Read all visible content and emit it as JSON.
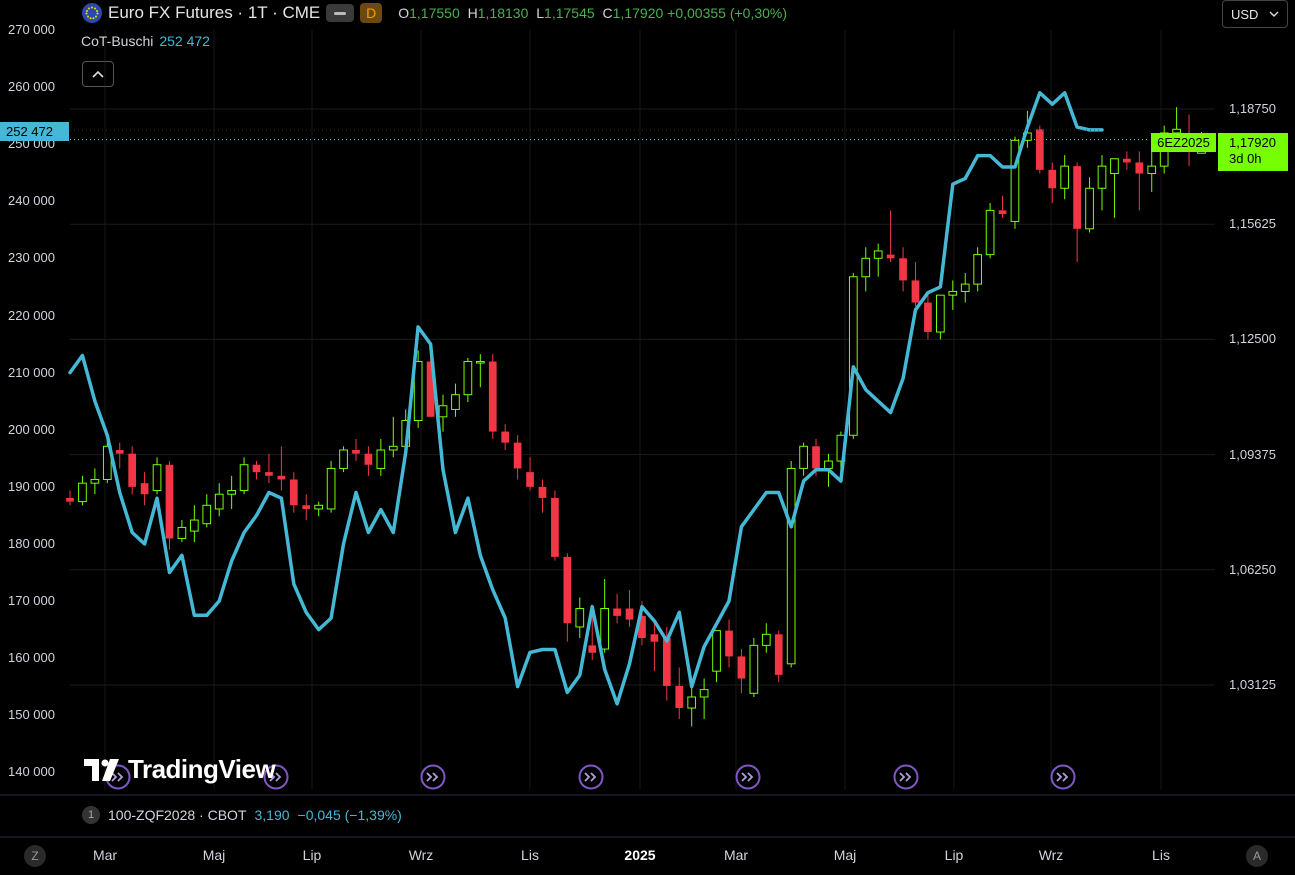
{
  "header": {
    "title": "Euro FX Futures · 1T · CME",
    "flag_icon": "eu-flag-icon",
    "d_badge": "D",
    "open_label": "O",
    "open_value": "1,17550",
    "high_label": "H",
    "high_value": "1,18130",
    "low_label": "L",
    "low_value": "1,17545",
    "close_label": "C",
    "close_value": "1,17920",
    "change": "+0,00355 (+0,30%)",
    "currency": "USD",
    "collapse_icon": "chevron-up-icon"
  },
  "indicator": {
    "name": "CoT-Buschi",
    "value": "252 472",
    "badge": "252 472",
    "color": "#45b8d6"
  },
  "price_badge": {
    "symbol": "6EZ2025",
    "price": "1,17920",
    "countdown": "3d 0h",
    "color": "#76ff03"
  },
  "watermark": "TradingView",
  "secondary_legend": {
    "number": "1",
    "symbol": "100-ZQF2028 · CBOT",
    "value": "3,190",
    "change": "−0,045 (−1,39%)"
  },
  "corner_left": "Z",
  "corner_right": "A",
  "colors": {
    "up": "#76ff03",
    "down": "#f23645",
    "cot_line": "#45b8d6",
    "event_icon": "#7e57c2"
  },
  "chart_data": {
    "type": "line",
    "left_axis": {
      "ticks": [
        "270 000",
        "260 000",
        "250 000",
        "240 000",
        "230 000",
        "220 000",
        "210 000",
        "200 000",
        "190 000",
        "180 000",
        "170 000",
        "160 000",
        "150 000",
        "140 000"
      ],
      "range": [
        140000,
        270000
      ]
    },
    "right_axis": {
      "ticks": [
        "1,18750",
        "1,15625",
        "1,12500",
        "1,09375",
        "1,06250",
        "1,03125"
      ],
      "range": [
        0.99,
        1.203
      ]
    },
    "time_axis": [
      "Mar",
      "Maj",
      "Lip",
      "Wrz",
      "Lis",
      "2025",
      "Mar",
      "Maj",
      "Lip",
      "Wrz",
      "Lis"
    ],
    "grid": true,
    "series": [
      {
        "name": "CoT-Buschi",
        "values": [
          210000,
          213000,
          205000,
          199000,
          189000,
          182000,
          180000,
          188000,
          175000,
          178000,
          167500,
          167500,
          170000,
          177000,
          182000,
          185000,
          189000,
          188000,
          173000,
          168000,
          165000,
          167000,
          180000,
          189000,
          182000,
          186000,
          182000,
          196000,
          218000,
          215000,
          193000,
          182000,
          188000,
          178000,
          172000,
          167000,
          155000,
          161000,
          161500,
          161500,
          154000,
          157000,
          169000,
          158000,
          152000,
          159000,
          169000,
          166500,
          163000,
          168000,
          155000,
          162000,
          166000,
          170000,
          183000,
          186000,
          189000,
          189000,
          183000,
          191000,
          193000,
          193000,
          191000,
          211000,
          207000,
          205000,
          203000,
          209000,
          221000,
          224000,
          225000,
          243000,
          244000,
          248000,
          248000,
          246000,
          246000,
          253000,
          259000,
          257000,
          259000,
          253000,
          252500,
          252500
        ]
      },
      {
        "name": "Euro FX Futures",
        "candles": [
          [
            1.082,
            1.084,
            1.08,
            1.081
          ],
          [
            1.081,
            1.088,
            1.08,
            1.086
          ],
          [
            1.086,
            1.09,
            1.083,
            1.087
          ],
          [
            1.087,
            1.099,
            1.086,
            1.096
          ],
          [
            1.095,
            1.097,
            1.09,
            1.094
          ],
          [
            1.094,
            1.096,
            1.083,
            1.085
          ],
          [
            1.086,
            1.089,
            1.08,
            1.083
          ],
          [
            1.084,
            1.093,
            1.083,
            1.091
          ],
          [
            1.091,
            1.092,
            1.068,
            1.071
          ],
          [
            1.071,
            1.076,
            1.07,
            1.074
          ],
          [
            1.073,
            1.08,
            1.07,
            1.076
          ],
          [
            1.075,
            1.083,
            1.074,
            1.08
          ],
          [
            1.079,
            1.086,
            1.077,
            1.083
          ],
          [
            1.083,
            1.088,
            1.079,
            1.084
          ],
          [
            1.084,
            1.093,
            1.083,
            1.091
          ],
          [
            1.091,
            1.092,
            1.087,
            1.089
          ],
          [
            1.089,
            1.094,
            1.086,
            1.088
          ],
          [
            1.088,
            1.096,
            1.084,
            1.087
          ],
          [
            1.087,
            1.089,
            1.078,
            1.08
          ],
          [
            1.08,
            1.083,
            1.076,
            1.079
          ],
          [
            1.079,
            1.081,
            1.077,
            1.08
          ],
          [
            1.079,
            1.092,
            1.078,
            1.09
          ],
          [
            1.09,
            1.096,
            1.089,
            1.095
          ],
          [
            1.095,
            1.098,
            1.092,
            1.094
          ],
          [
            1.094,
            1.096,
            1.088,
            1.091
          ],
          [
            1.09,
            1.098,
            1.088,
            1.095
          ],
          [
            1.095,
            1.104,
            1.093,
            1.096
          ],
          [
            1.096,
            1.106,
            1.095,
            1.103
          ],
          [
            1.103,
            1.122,
            1.101,
            1.119
          ],
          [
            1.119,
            1.122,
            1.105,
            1.104
          ],
          [
            1.104,
            1.11,
            1.1,
            1.107
          ],
          [
            1.106,
            1.113,
            1.104,
            1.11
          ],
          [
            1.11,
            1.12,
            1.108,
            1.119
          ],
          [
            1.119,
            1.121,
            1.112,
            1.119
          ],
          [
            1.119,
            1.121,
            1.098,
            1.1
          ],
          [
            1.1,
            1.102,
            1.095,
            1.097
          ],
          [
            1.097,
            1.099,
            1.087,
            1.09
          ],
          [
            1.089,
            1.093,
            1.084,
            1.085
          ],
          [
            1.085,
            1.087,
            1.078,
            1.082
          ],
          [
            1.082,
            1.084,
            1.065,
            1.066
          ],
          [
            1.066,
            1.067,
            1.043,
            1.048
          ],
          [
            1.047,
            1.055,
            1.044,
            1.052
          ],
          [
            1.042,
            1.053,
            1.038,
            1.04
          ],
          [
            1.041,
            1.06,
            1.04,
            1.052
          ],
          [
            1.052,
            1.056,
            1.048,
            1.05
          ],
          [
            1.052,
            1.057,
            1.047,
            1.049
          ],
          [
            1.05,
            1.054,
            1.042,
            1.044
          ],
          [
            1.045,
            1.048,
            1.035,
            1.043
          ],
          [
            1.044,
            1.047,
            1.027,
            1.031
          ],
          [
            1.031,
            1.036,
            1.022,
            1.025
          ],
          [
            1.025,
            1.031,
            1.02,
            1.028
          ],
          [
            1.028,
            1.033,
            1.022,
            1.03
          ],
          [
            1.035,
            1.046,
            1.032,
            1.046
          ],
          [
            1.046,
            1.049,
            1.036,
            1.039
          ],
          [
            1.039,
            1.041,
            1.029,
            1.033
          ],
          [
            1.029,
            1.044,
            1.028,
            1.042
          ],
          [
            1.042,
            1.048,
            1.04,
            1.045
          ],
          [
            1.045,
            1.046,
            1.032,
            1.034
          ],
          [
            1.037,
            1.092,
            1.036,
            1.09
          ],
          [
            1.09,
            1.097,
            1.088,
            1.096
          ],
          [
            1.096,
            1.098,
            1.088,
            1.09
          ],
          [
            1.09,
            1.094,
            1.085,
            1.092
          ],
          [
            1.092,
            1.1,
            1.087,
            1.099
          ],
          [
            1.099,
            1.143,
            1.098,
            1.142
          ],
          [
            1.142,
            1.15,
            1.138,
            1.147
          ],
          [
            1.147,
            1.151,
            1.142,
            1.149
          ],
          [
            1.148,
            1.16,
            1.146,
            1.147
          ],
          [
            1.147,
            1.15,
            1.138,
            1.141
          ],
          [
            1.141,
            1.146,
            1.134,
            1.135
          ],
          [
            1.135,
            1.138,
            1.125,
            1.127
          ],
          [
            1.127,
            1.137,
            1.125,
            1.137
          ],
          [
            1.137,
            1.141,
            1.133,
            1.138
          ],
          [
            1.138,
            1.143,
            1.135,
            1.14
          ],
          [
            1.14,
            1.15,
            1.138,
            1.148
          ],
          [
            1.148,
            1.162,
            1.147,
            1.16
          ],
          [
            1.16,
            1.164,
            1.158,
            1.159
          ],
          [
            1.157,
            1.18,
            1.155,
            1.179
          ],
          [
            1.179,
            1.187,
            1.177,
            1.181
          ],
          [
            1.182,
            1.183,
            1.17,
            1.171
          ],
          [
            1.171,
            1.173,
            1.162,
            1.166
          ],
          [
            1.166,
            1.175,
            1.163,
            1.172
          ],
          [
            1.172,
            1.173,
            1.146,
            1.155
          ],
          [
            1.155,
            1.169,
            1.154,
            1.166
          ],
          [
            1.166,
            1.175,
            1.16,
            1.172
          ],
          [
            1.17,
            1.171,
            1.158,
            1.174
          ],
          [
            1.174,
            1.176,
            1.171,
            1.173
          ],
          [
            1.173,
            1.176,
            1.16,
            1.17
          ],
          [
            1.17,
            1.179,
            1.165,
            1.172
          ],
          [
            1.172,
            1.183,
            1.17,
            1.181
          ],
          [
            1.181,
            1.188,
            1.179,
            1.182
          ],
          [
            1.181,
            1.186,
            1.172,
            1.176
          ],
          [
            1.1755,
            1.1813,
            1.1754,
            1.1792
          ]
        ]
      }
    ]
  }
}
